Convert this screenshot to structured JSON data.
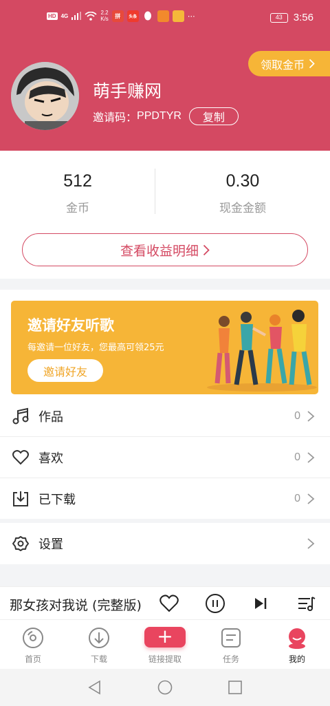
{
  "status_bar": {
    "hd": "HD",
    "network": "4G",
    "speed_value": "2.2",
    "speed_unit": "K/s",
    "apps": [
      "拼",
      "头条",
      "",
      "",
      ""
    ],
    "battery": "43",
    "time": "3:56"
  },
  "header": {
    "claim_coins": "领取金币",
    "username": "萌手赚网",
    "invite_label": "邀请码：",
    "invite_code": "PPDTYR",
    "copy_label": "复制"
  },
  "stats": {
    "coins_value": "512",
    "coins_label": "金币",
    "cash_value": "0.30",
    "cash_label": "现金金额",
    "detail_button": "查看收益明细"
  },
  "banner": {
    "title": "邀请好友听歌",
    "subtitle": "每邀请一位好友，您最高可领25元",
    "button": "邀请好友"
  },
  "menu": {
    "items": [
      {
        "label": "作品",
        "count": "0",
        "icon": "music-note-icon"
      },
      {
        "label": "喜欢",
        "count": "0",
        "icon": "heart-icon"
      },
      {
        "label": "已下载",
        "count": "0",
        "icon": "download-icon"
      }
    ],
    "settings": {
      "label": "设置",
      "icon": "gear-icon"
    }
  },
  "player": {
    "song_title": "那女孩对我说 (完整版)"
  },
  "tabs": [
    {
      "label": "首页",
      "icon": "disc-icon"
    },
    {
      "label": "下载",
      "icon": "download-circle-icon"
    },
    {
      "label": "链接提取",
      "icon": "plus-icon"
    },
    {
      "label": "任务",
      "icon": "task-icon"
    },
    {
      "label": "我的",
      "icon": "profile-icon",
      "active": true
    }
  ],
  "colors": {
    "brand": "#d44962",
    "accent": "#f6b537",
    "plus": "#e9455f"
  }
}
